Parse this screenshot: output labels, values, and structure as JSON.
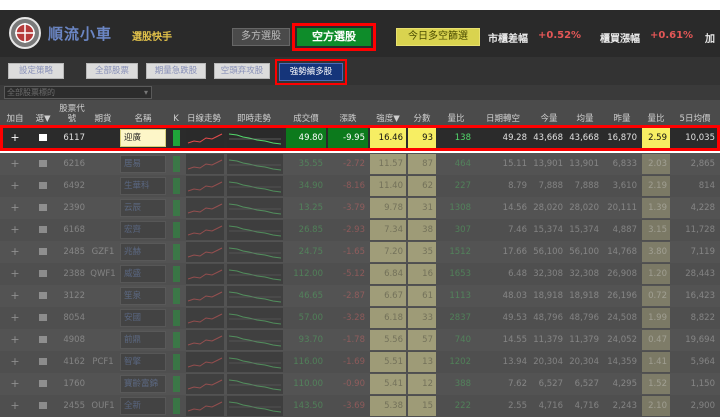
{
  "header": {
    "brand": "順流小車",
    "brand_sub": "選股快手",
    "mode_long": "多方選股",
    "mode_short": "空方選股",
    "mode_today": "今日多空篩選",
    "market_change_label": "市櫃差幅",
    "market_change_value": "+0.52%",
    "otc_change_label": "櫃買漲幅",
    "otc_change_value": "+0.61%",
    "extra_label": "加"
  },
  "toolbar": {
    "btn_settings": "設定策略",
    "btn_all": "全部股票",
    "btn_preset": "期量急跌股",
    "btn_attack": "空頭弃攻股",
    "btn_strong": "強勢續多股"
  },
  "filter": {
    "value": "全部股票標的",
    "arrow": "▾"
  },
  "columns": [
    "加自",
    "選▼",
    "股票代號",
    "期貨",
    "名稱",
    "K",
    "日線走勢",
    "即時走勢",
    "成交價",
    "漲跌",
    "強度▼",
    "分數",
    "量比",
    "日期轉空",
    "今量",
    "均量",
    "昨量",
    "量比",
    "5日均價"
  ],
  "rows": [
    {
      "code": "6117",
      "fut": "",
      "name": "迎廣",
      "price": "49.80",
      "chg": "-9.95",
      "str": "16.46",
      "score": "93",
      "vr": "138",
      "d": "49.28",
      "v1": "43,668",
      "v2": "43,668",
      "v3": "16,870",
      "r": "2.59",
      "last": "10,035"
    },
    {
      "code": "6216",
      "fut": "",
      "name": "居易",
      "price": "35.55",
      "chg": "-2.72",
      "str": "11.57",
      "score": "87",
      "vr": "464",
      "d": "15.11",
      "v1": "13,901",
      "v2": "13,901",
      "v3": "6,833",
      "r": "2.03",
      "last": "2,865"
    },
    {
      "code": "6492",
      "fut": "",
      "name": "生華科",
      "price": "34.90",
      "chg": "-8.16",
      "str": "11.40",
      "score": "62",
      "vr": "227",
      "d": "8.79",
      "v1": "7,888",
      "v2": "7,888",
      "v3": "3,610",
      "r": "2.19",
      "last": "814"
    },
    {
      "code": "2390",
      "fut": "",
      "name": "云辰",
      "price": "13.25",
      "chg": "-3.79",
      "str": "9.78",
      "score": "31",
      "vr": "1308",
      "d": "14.56",
      "v1": "28,020",
      "v2": "28,020",
      "v3": "20,111",
      "r": "1.39",
      "last": "4,228"
    },
    {
      "code": "6168",
      "fut": "",
      "name": "宏齊",
      "price": "26.85",
      "chg": "-2.93",
      "str": "7.34",
      "score": "38",
      "vr": "307",
      "d": "7.46",
      "v1": "15,374",
      "v2": "15,374",
      "v3": "4,887",
      "r": "3.15",
      "last": "11,728"
    },
    {
      "code": "2485",
      "fut": "GZF1",
      "name": "兆赫",
      "price": "24.75",
      "chg": "-1.65",
      "str": "7.20",
      "score": "35",
      "vr": "1512",
      "d": "17.66",
      "v1": "56,100",
      "v2": "56,100",
      "v3": "14,768",
      "r": "3.80",
      "last": "7,119"
    },
    {
      "code": "2388",
      "fut": "QWF1",
      "name": "威盛",
      "price": "112.00",
      "chg": "-5.12",
      "str": "6.84",
      "score": "16",
      "vr": "1653",
      "d": "6.48",
      "v1": "32,308",
      "v2": "32,308",
      "v3": "26,908",
      "r": "1.20",
      "last": "28,443"
    },
    {
      "code": "3122",
      "fut": "",
      "name": "笙泉",
      "price": "46.65",
      "chg": "-2.87",
      "str": "6.67",
      "score": "61",
      "vr": "1113",
      "d": "48.03",
      "v1": "18,918",
      "v2": "18,918",
      "v3": "26,196",
      "r": "0.72",
      "last": "16,423"
    },
    {
      "code": "8054",
      "fut": "",
      "name": "安國",
      "price": "57.00",
      "chg": "-3.28",
      "str": "6.18",
      "score": "33",
      "vr": "2837",
      "d": "49.53",
      "v1": "48,796",
      "v2": "48,796",
      "v3": "24,508",
      "r": "1.99",
      "last": "8,822"
    },
    {
      "code": "4908",
      "fut": "",
      "name": "前鼎",
      "price": "93.70",
      "chg": "-1.78",
      "str": "5.56",
      "score": "57",
      "vr": "740",
      "d": "14.55",
      "v1": "11,379",
      "v2": "11,379",
      "v3": "24,052",
      "r": "0.47",
      "last": "19,694"
    },
    {
      "code": "4162",
      "fut": "PCF1",
      "name": "智擎",
      "price": "116.00",
      "chg": "-1.69",
      "str": "5.51",
      "score": "13",
      "vr": "1202",
      "d": "13.94",
      "v1": "20,304",
      "v2": "20,304",
      "v3": "14,359",
      "r": "1.41",
      "last": "5,964"
    },
    {
      "code": "1760",
      "fut": "",
      "name": "寶齡富錦",
      "price": "110.00",
      "chg": "-0.90",
      "str": "5.41",
      "score": "12",
      "vr": "388",
      "d": "7.62",
      "v1": "6,527",
      "v2": "6,527",
      "v3": "4,295",
      "r": "1.52",
      "last": "1,150"
    },
    {
      "code": "2455",
      "fut": "OUF1",
      "name": "全新",
      "price": "143.50",
      "chg": "-3.69",
      "str": "5.38",
      "score": "15",
      "vr": "222",
      "d": "2.55",
      "v1": "4,716",
      "v2": "4,716",
      "v3": "2,243",
      "r": "2.10",
      "last": "2,900"
    }
  ],
  "colors": {
    "highlight": "#ff0000",
    "green": "#0c7a1c",
    "yellow": "#f7ee63",
    "header_bg": "#2a2a2a"
  }
}
